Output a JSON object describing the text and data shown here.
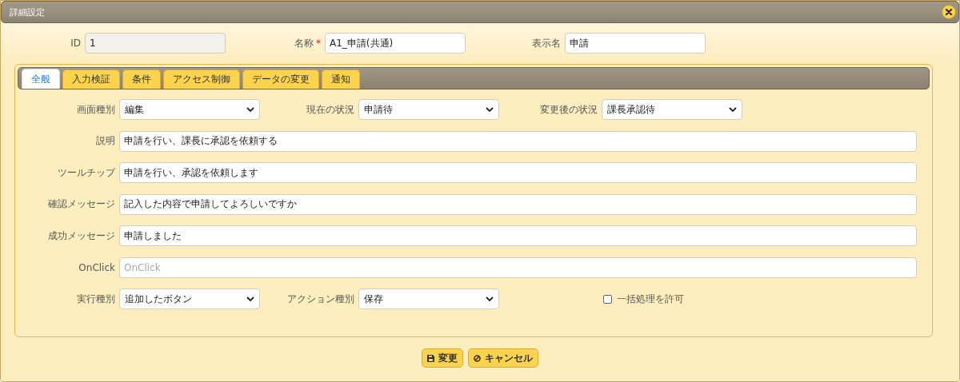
{
  "window": {
    "title": "詳細設定"
  },
  "header_fields": [
    {
      "label": "ID",
      "value": "1",
      "disabled": true
    },
    {
      "label": "名称",
      "required_mark": "*",
      "value": "A1_申請(共通)",
      "disabled": false
    },
    {
      "label": "表示名",
      "value": "申請",
      "disabled": false
    }
  ],
  "tabs": [
    {
      "label": "全般",
      "selected": true
    },
    {
      "label": "入力検証",
      "selected": false
    },
    {
      "label": "条件",
      "selected": false
    },
    {
      "label": "アクセス制御",
      "selected": false
    },
    {
      "label": "データの変更",
      "selected": false
    },
    {
      "label": "通知",
      "selected": false
    }
  ],
  "form_rows": [
    {
      "fields": [
        {
          "kind": "select",
          "label": "画面種別",
          "value": "編集"
        },
        {
          "kind": "select",
          "label": "現在の状況",
          "value": "申請待"
        },
        {
          "kind": "select",
          "label": "変更後の状況",
          "value": "課長承認待"
        }
      ]
    },
    {
      "fields": [
        {
          "kind": "text",
          "label": "説明",
          "value": "申請を行い、課長に承認を依頼する"
        }
      ]
    },
    {
      "fields": [
        {
          "kind": "text",
          "label": "ツールチップ",
          "value": "申請を行い、承認を依頼します"
        }
      ]
    },
    {
      "fields": [
        {
          "kind": "text",
          "label": "確認メッセージ",
          "value": "記入した内容で申請してよろしいですか"
        }
      ]
    },
    {
      "fields": [
        {
          "kind": "text",
          "label": "成功メッセージ",
          "value": "申請しました"
        }
      ]
    },
    {
      "fields": [
        {
          "kind": "text",
          "label": "OnClick",
          "placeholder": "OnClick"
        }
      ]
    },
    {
      "fields": [
        {
          "kind": "select",
          "label": "実行種別",
          "value": "追加したボタン"
        },
        {
          "kind": "select",
          "label": "アクション種別",
          "value": "保存"
        },
        {
          "kind": "checkbox",
          "label": "一括処理を許可",
          "checked": false
        }
      ]
    }
  ],
  "buttons": [
    {
      "kind": "save",
      "label": "変更"
    },
    {
      "kind": "cancel",
      "label": "キャンセル"
    }
  ]
}
